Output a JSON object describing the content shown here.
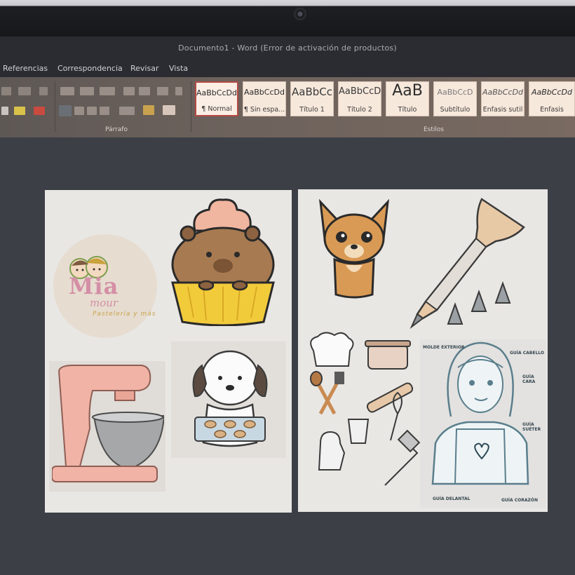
{
  "window": {
    "title": "Documento1 - Word (Error de activación de productos)"
  },
  "ribbon_tabs": [
    "Referencias",
    "Correspondencia",
    "Revisar",
    "Vista"
  ],
  "groups": {
    "paragraph": "Párrafo",
    "styles": "Estilos"
  },
  "style_gallery": [
    {
      "sample": "AaBbCcDd",
      "name": "¶ Normal",
      "selected": true
    },
    {
      "sample": "AaBbCcDd",
      "name": "¶ Sin espa..."
    },
    {
      "sample": "AaBbCc",
      "name": "Título 1"
    },
    {
      "sample": "AaBbCcD",
      "name": "Título 2"
    },
    {
      "sample": "AaB",
      "name": "Título"
    },
    {
      "sample": "AaBbCcD",
      "name": "Subtítulo"
    },
    {
      "sample": "AaBbCcDd",
      "name": "Énfasis sutil"
    },
    {
      "sample": "AaBbCcDd",
      "name": "Énfasis"
    }
  ],
  "logo": {
    "name_line1": "Mia",
    "name_line2": "mour",
    "tagline": "Pastelería y más"
  },
  "guide_labels": {
    "outer_mold": "MOLDE EXTERIOR",
    "hair": "GUÍA CABELLO",
    "face": "GUÍA CARA",
    "sweater": "GUÍA SUÉTER",
    "apron": "GUÍA DELANTAL",
    "heart": "GUÍA CORAZÓN"
  },
  "colors": {
    "accent_red": "#b44a44",
    "logo_pink": "#d48fa6",
    "logo_circle": "#e6dcd0"
  }
}
